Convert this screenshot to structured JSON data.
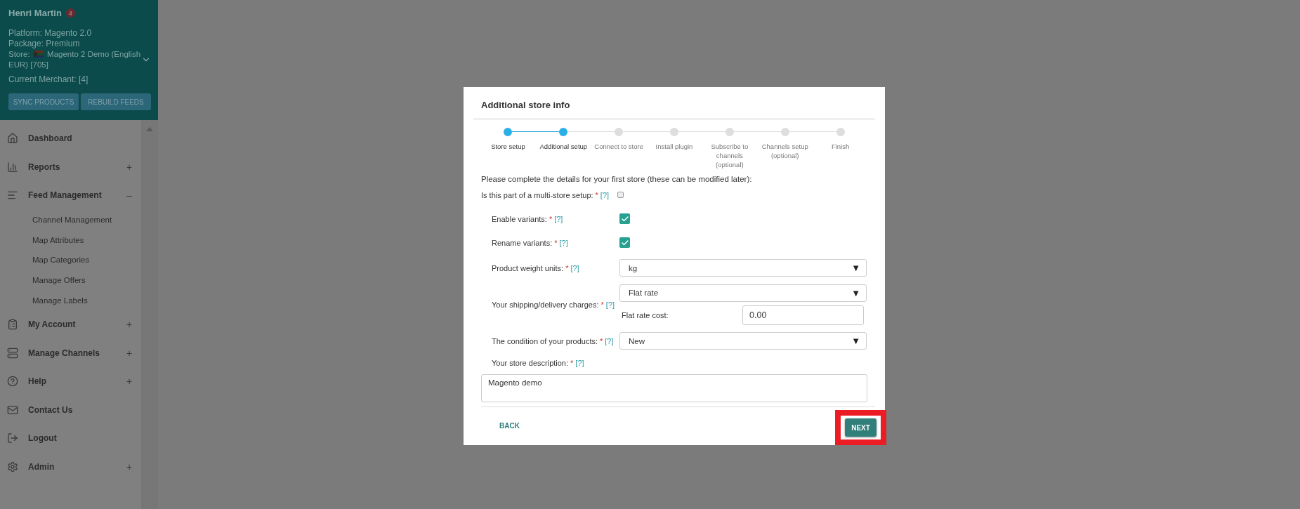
{
  "account": {
    "name": "Henri Martin",
    "badge": "4",
    "platform": "Platform: Magento 2.0",
    "package": "Package: Premium",
    "store_prefix": "Store:",
    "store": "Magento 2 Demo (English EUR) [705]",
    "merchant": "Current Merchant: [4]",
    "buttons": [
      "SYNC PRODUCTS",
      "REBUILD FEEDS"
    ]
  },
  "menu": [
    {
      "label": "Dashboard"
    },
    {
      "label": "Reports",
      "toggle": "+"
    },
    {
      "label": "Feed Management",
      "toggle": "–",
      "children": [
        {
          "label": "Channel Management"
        },
        {
          "label": "Map Attributes"
        },
        {
          "label": "Map Categories"
        },
        {
          "label": "Manage Offers"
        },
        {
          "label": "Manage Labels"
        }
      ]
    },
    {
      "label": "My Account",
      "toggle": "+"
    },
    {
      "label": "Manage Channels",
      "toggle": "+"
    },
    {
      "label": "Help",
      "toggle": "+"
    },
    {
      "label": "Contact Us"
    },
    {
      "label": "Logout"
    },
    {
      "label": "Admin",
      "toggle": "+"
    }
  ],
  "dialog": {
    "title": "Additional store info",
    "steps": [
      {
        "label": "Store setup",
        "done": true
      },
      {
        "label": "Additional setup",
        "done": true
      },
      {
        "label": "Connect to store",
        "done": false
      },
      {
        "label": "Install plugin",
        "done": false
      },
      {
        "label": "Subscribe to channels (optional)",
        "done": false
      },
      {
        "label": "Channels setup (optional)",
        "done": false
      },
      {
        "label": "Finish",
        "done": false
      }
    ],
    "intro": "Please complete the details for your first store (these can be modified later):",
    "multi_store": {
      "label": "Is this part of a multi-store setup:",
      "required": "*",
      "help": "[?]",
      "checked": false
    },
    "fields": [
      {
        "kind": "checkbox",
        "label": "Enable variants:",
        "required": "*",
        "help": "[?]",
        "checked": true
      },
      {
        "kind": "checkbox",
        "label": "Rename variants:",
        "required": "*",
        "help": "[?]",
        "checked": true
      },
      {
        "kind": "select",
        "label": "Product weight units:",
        "required": "*",
        "help": "[?]",
        "value": "kg",
        "arrow": "▼"
      },
      {
        "kind": "shipping",
        "label": "Your shipping/delivery charges:",
        "required": "*",
        "help": "[?]",
        "value": "Flat rate",
        "arrow": "▼",
        "cost_label": "Flat rate cost:",
        "cost": "0.00"
      },
      {
        "kind": "select",
        "label": "The condition of your products:",
        "required": "*",
        "help": "[?]",
        "value": "New",
        "arrow": "▼"
      }
    ],
    "description": {
      "label": "Your store description:",
      "required": "*",
      "help": "[?]",
      "value": "Magento demo"
    },
    "back": "BACK",
    "next": "NEXT"
  }
}
